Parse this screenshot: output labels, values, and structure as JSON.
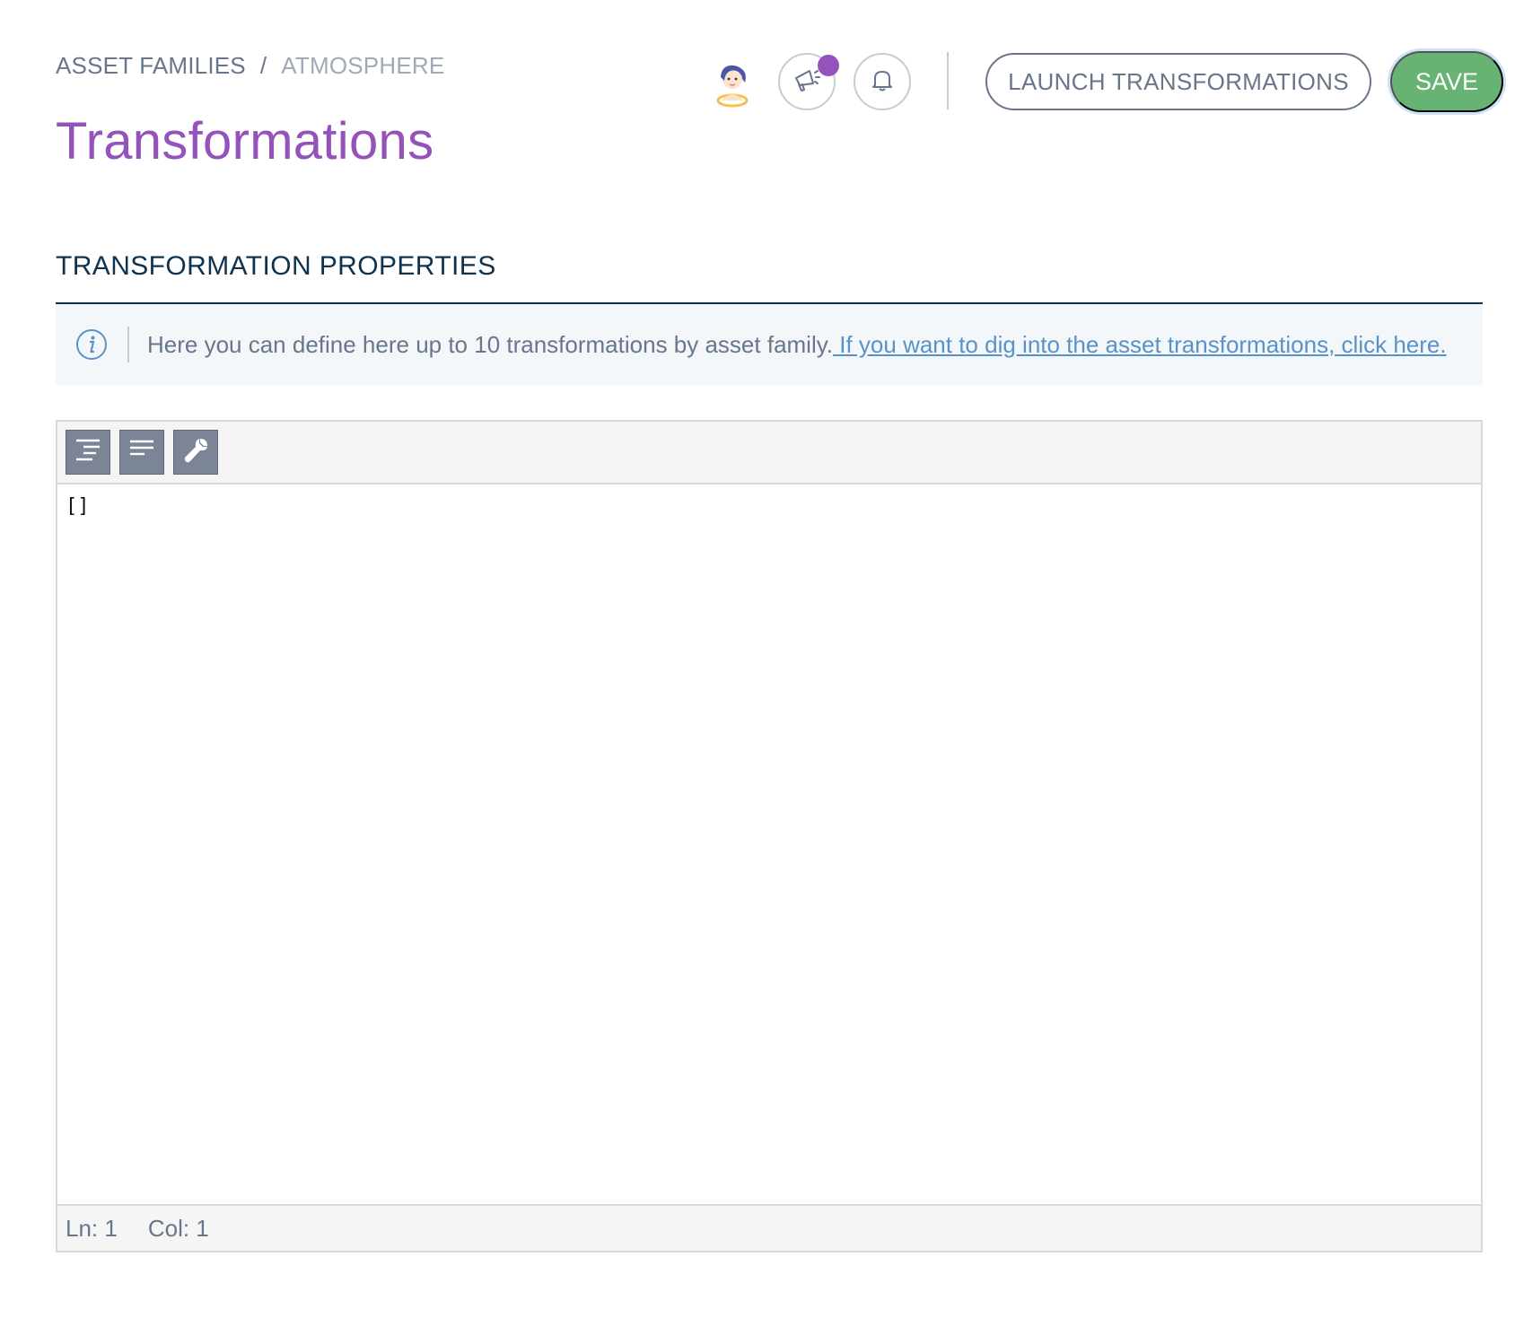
{
  "breadcrumb": {
    "parent": "ASSET FAMILIES",
    "separator": "/",
    "current": "ATMOSPHERE"
  },
  "page_title": "Transformations",
  "header": {
    "avatar_icon": "user-avatar-icon",
    "announcements_icon": "megaphone-icon",
    "notifications_icon": "bell-icon",
    "launch_label": "LAUNCH TRANSFORMATIONS",
    "save_label": "SAVE"
  },
  "section": {
    "title": "TRANSFORMATION PROPERTIES"
  },
  "helper": {
    "icon": "info-icon",
    "text": "Here you can define here up to 10 transformations by asset family.",
    "link_text": " If you want to dig into the asset transformations, click here."
  },
  "editor": {
    "toolbar": [
      {
        "icon": "format-indent-icon"
      },
      {
        "icon": "compact-text-icon"
      },
      {
        "icon": "wrench-icon"
      }
    ],
    "content": "[]",
    "status": {
      "line": "Ln: 1",
      "col": "Col: 1"
    }
  },
  "colors": {
    "brand_purple": "#9452ba",
    "save_green": "#67b373",
    "link_blue": "#5992c7",
    "text_grey": "#67768a",
    "dark_blue": "#11324d"
  }
}
